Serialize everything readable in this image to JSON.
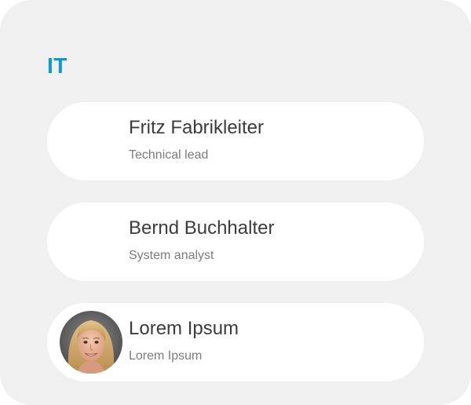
{
  "colors": {
    "accent": "#0a9bd1",
    "panel_background": "#f0f0f0",
    "card_background": "#ffffff",
    "name_text": "#3c3c3c",
    "role_text": "#7c7c7c"
  },
  "section": {
    "title": "IT"
  },
  "people": [
    {
      "name": "Fritz Fabrikleiter",
      "role": "Technical lead",
      "has_avatar": false
    },
    {
      "name": "Bernd Buchhalter",
      "role": "System analyst",
      "has_avatar": false
    },
    {
      "name": "Lorem Ipsum",
      "role": "Lorem Ipsum",
      "has_avatar": true,
      "avatar_icon": "person-photo-avatar"
    }
  ]
}
